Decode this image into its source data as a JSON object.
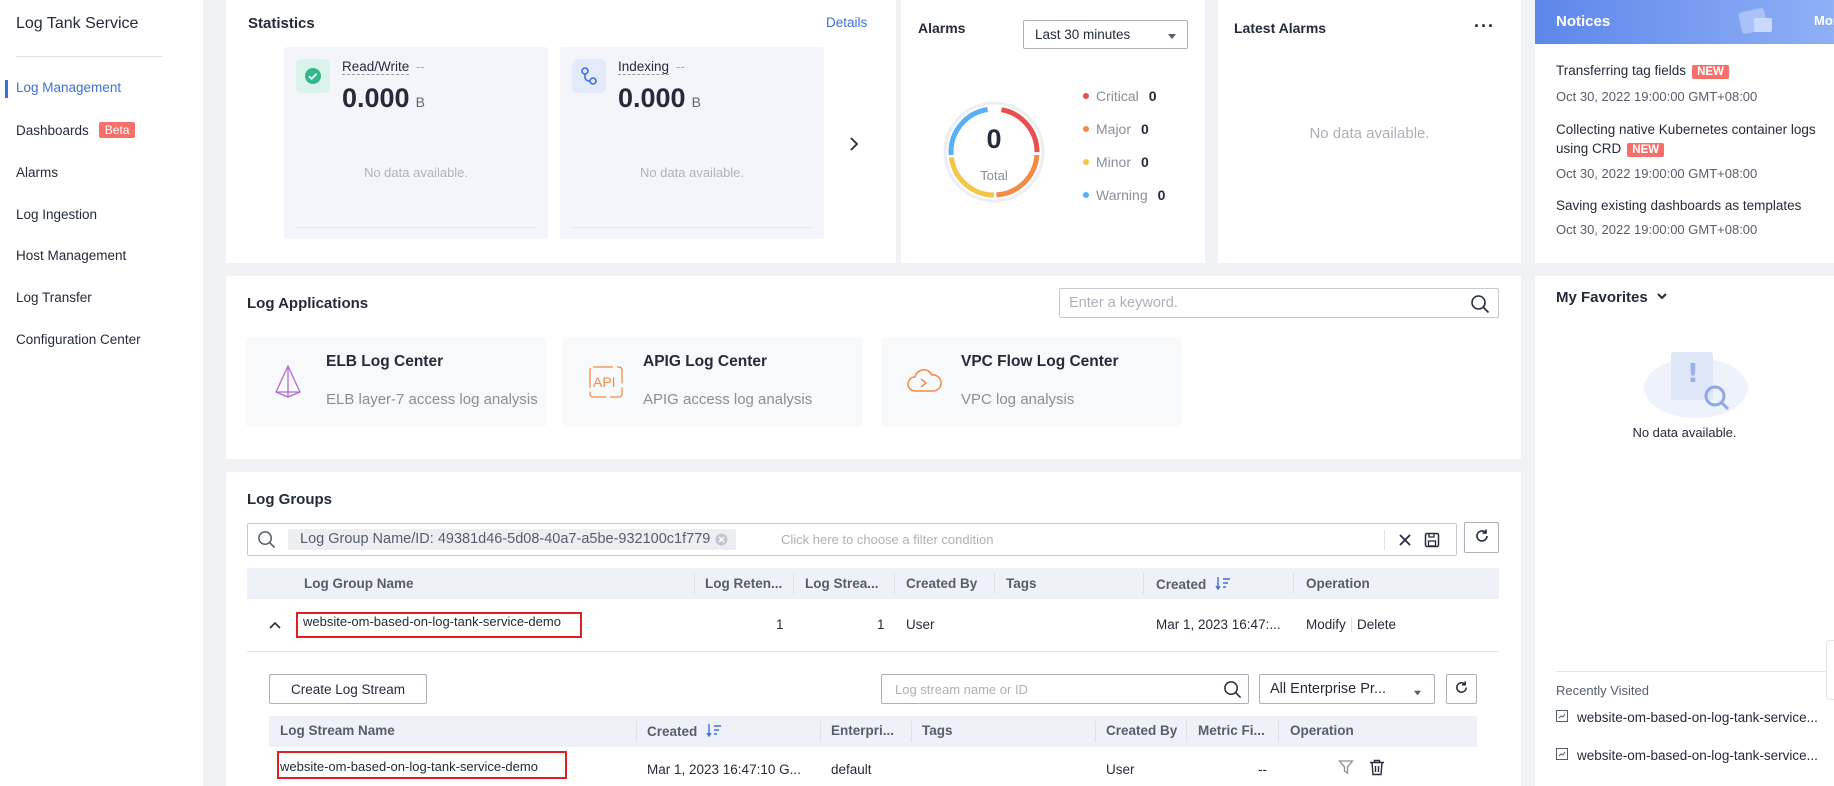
{
  "sidebar": {
    "brand": "Log Tank Service",
    "items": [
      {
        "label": "Log Management",
        "active": true
      },
      {
        "label": "Dashboards",
        "badge": "Beta"
      },
      {
        "label": "Alarms"
      },
      {
        "label": "Log Ingestion"
      },
      {
        "label": "Host Management"
      },
      {
        "label": "Log Transfer"
      },
      {
        "label": "Configuration Center"
      }
    ]
  },
  "statistics": {
    "title": "Statistics",
    "details_link": "Details",
    "cards": [
      {
        "label": "Read/Write",
        "trend": "--",
        "value": "0.000",
        "unit": "B",
        "empty": "No data available.",
        "icon": "check-circle-icon"
      },
      {
        "label": "Indexing",
        "trend": "--",
        "value": "0.000",
        "unit": "B",
        "empty": "No data available.",
        "icon": "index-nodes-icon"
      }
    ]
  },
  "alarms": {
    "title": "Alarms",
    "range_select": "Last 30 minutes",
    "total_value": "0",
    "total_label": "Total",
    "legend": [
      {
        "label": "Critical",
        "count": "0",
        "color": "#e8504f"
      },
      {
        "label": "Major",
        "count": "0",
        "color": "#f28b48"
      },
      {
        "label": "Minor",
        "count": "0",
        "color": "#f5c54a"
      },
      {
        "label": "Warning",
        "count": "0",
        "color": "#5aaef3"
      }
    ]
  },
  "latest_alarms": {
    "title": "Latest Alarms",
    "more": "···",
    "empty": "No data available."
  },
  "notices": {
    "title": "Notices",
    "more": "Mor",
    "items": [
      {
        "text": "Transferring tag fields",
        "badge": "NEW",
        "time": "Oct 30, 2022 19:00:00 GMT+08:00"
      },
      {
        "text_line1": "Collecting native Kubernetes container logs",
        "text_line2": "using CRD",
        "badge": "NEW",
        "time": "Oct 30, 2022 19:00:00 GMT+08:00"
      },
      {
        "text": "Saving existing dashboards as templates",
        "time": "Oct 30, 2022 19:00:00 GMT+08:00"
      }
    ]
  },
  "log_applications": {
    "title": "Log Applications",
    "search_placeholder": "Enter a keyword.",
    "apps": [
      {
        "title": "ELB Log Center",
        "desc": "ELB layer-7 access log analysis"
      },
      {
        "title": "APIG Log Center",
        "desc": "APIG access log analysis",
        "icon_text": "API"
      },
      {
        "title": "VPC Flow Log Center",
        "desc": "VPC log analysis"
      }
    ]
  },
  "favorites": {
    "title": "My Favorites",
    "empty": "No data available.",
    "recent_title": "Recently Visited",
    "recent": [
      "website-om-based-on-log-tank-service...",
      "website-om-based-on-log-tank-service..."
    ]
  },
  "log_groups": {
    "title": "Log Groups",
    "filter_chip": "Log Group Name/ID: 49381d46-5d08-40a7-a5be-932100c1f779",
    "filter_placeholder": "Click here to choose a filter condition",
    "columns": [
      "Log Group Name",
      "Log Reten...",
      "Log Strea...",
      "Created By",
      "Tags",
      "Created",
      "Operation"
    ],
    "rows": [
      {
        "name": "website-om-based-on-log-tank-service-demo",
        "retention": "1",
        "streams": "1",
        "created_by": "User",
        "tags": "",
        "created": "Mar 1, 2023 16:47:...",
        "op_modify": "Modify",
        "op_delete": "Delete"
      }
    ],
    "streams": {
      "create_button": "Create Log Stream",
      "search_placeholder": "Log stream name or ID",
      "project_select": "All Enterprise Pr...",
      "columns": [
        "Log Stream Name",
        "Created",
        "Enterpri...",
        "Tags",
        "Created By",
        "Metric Fi...",
        "Operation"
      ],
      "rows": [
        {
          "name": "website-om-based-on-log-tank-service-demo",
          "created": "Mar 1, 2023 16:47:10 G...",
          "enterprise": "default",
          "tags": "",
          "created_by": "User",
          "metric": "--"
        }
      ]
    }
  }
}
